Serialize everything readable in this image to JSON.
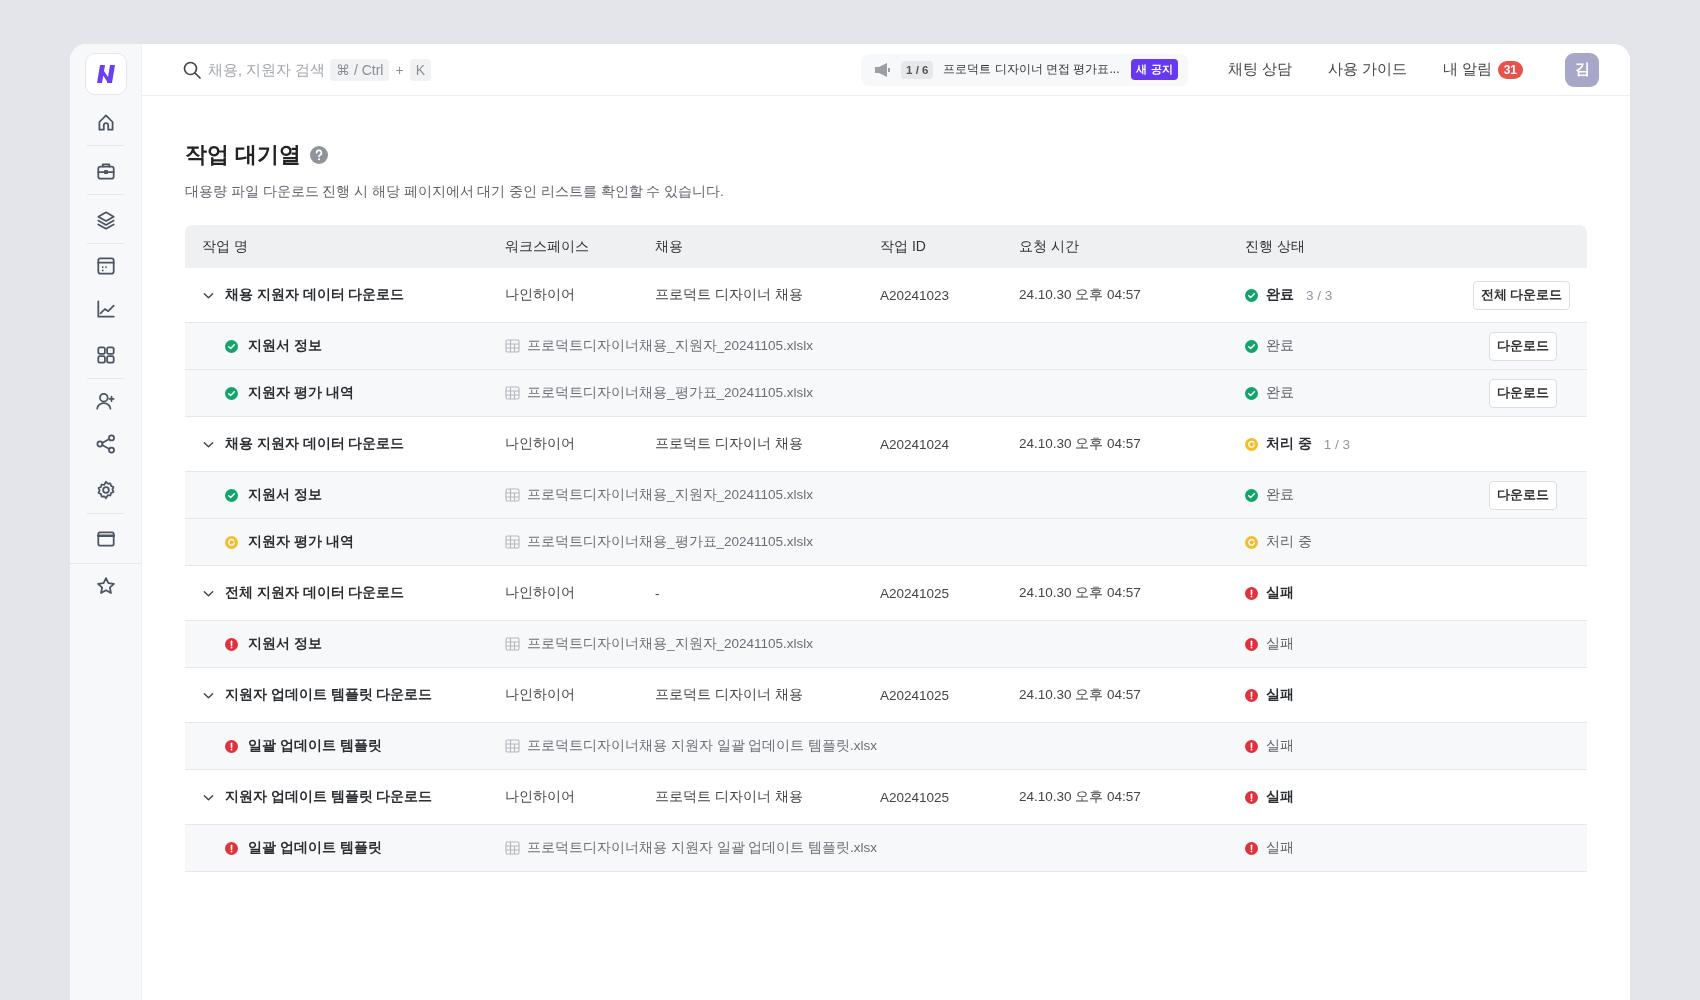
{
  "topbar": {
    "search": {
      "placeholder": "채용, 지원자 검색",
      "shortcut": [
        "⌘ / Ctrl",
        "K"
      ],
      "joiner": "+"
    },
    "notice": {
      "counter": "1 / 6",
      "text": "프로덕트 디자이너 면접 평가표...",
      "badge": "새 공지"
    },
    "links": [
      "채팅 상담",
      "사용 가이드"
    ],
    "alerts": {
      "label": "내 알림",
      "count": "31"
    },
    "avatar": "김"
  },
  "page": {
    "title": "작업 대기열",
    "description": "대용량 파일 다운로드 진행 시 해당 페이지에서 대기 중인 리스트를 확인할 수 있습니다."
  },
  "table": {
    "columns": [
      "작업 명",
      "워크스페이스",
      "채용",
      "작업 ID",
      "요청 시간",
      "진행 상태"
    ],
    "jobs": [
      {
        "name": "채용 지원자 데이터 다운로드",
        "expanded": true,
        "workspace": "나인하이어",
        "recruitment": "프로덕트 디자이너 채용",
        "job_id": "A20241023",
        "requested_at": "24.10.30 오후 04:57",
        "kind": "done",
        "status_label": "완료",
        "progress": "3 / 3",
        "action": "전체 다운로드",
        "children": [
          {
            "name": "지원서 정보",
            "kind": "done",
            "file": "프로덕트디자이너채용_지원자_20241105.xlslx",
            "status_label": "완료",
            "action": "다운로드"
          },
          {
            "name": "지원자 평가 내역",
            "kind": "done",
            "file": "프로덕트디자이너채용_평가표_20241105.xlslx",
            "status_label": "완료",
            "action": "다운로드"
          }
        ]
      },
      {
        "name": "채용 지원자 데이터 다운로드",
        "expanded": true,
        "workspace": "나인하이어",
        "recruitment": "프로덕트 디자이너 채용",
        "job_id": "A20241024",
        "requested_at": "24.10.30 오후 04:57",
        "kind": "processing",
        "status_label": "처리 중",
        "progress": "1 / 3",
        "children": [
          {
            "name": "지원서 정보",
            "kind": "done",
            "file": "프로덕트디자이너채용_지원자_20241105.xlslx",
            "status_label": "완료",
            "action": "다운로드"
          },
          {
            "name": "지원자 평가 내역",
            "kind": "processing",
            "file": "프로덕트디자이너채용_평가표_20241105.xlslx",
            "status_label": "처리 중"
          }
        ]
      },
      {
        "name": "전체 지원자 데이터 다운로드",
        "expanded": true,
        "workspace": "나인하이어",
        "recruitment": "-",
        "job_id": "A20241025",
        "requested_at": "24.10.30 오후 04:57",
        "kind": "failed",
        "status_label": "실패",
        "children": [
          {
            "name": "지원서 정보",
            "kind": "failed",
            "file": "프로덕트디자이너채용_지원자_20241105.xlslx",
            "status_label": "실패"
          }
        ]
      },
      {
        "name": "지원자 업데이트 템플릿 다운로드",
        "expanded": true,
        "workspace": "나인하이어",
        "recruitment": "프로덕트 디자이너 채용",
        "job_id": "A20241025",
        "requested_at": "24.10.30 오후 04:57",
        "kind": "failed",
        "status_label": "실패",
        "children": [
          {
            "name": "일괄 업데이트 템플릿",
            "kind": "failed",
            "file": "프로덕트디자이너채용 지원자 일괄 업데이트 템플릿.xlsx",
            "status_label": "실패"
          }
        ]
      },
      {
        "name": "지원자 업데이트 템플릿 다운로드",
        "expanded": true,
        "workspace": "나인하이어",
        "recruitment": "프로덕트 디자이너 채용",
        "job_id": "A20241025",
        "requested_at": "24.10.30 오후 04:57",
        "kind": "failed",
        "status_label": "실패",
        "children": [
          {
            "name": "일괄 업데이트 템플릿",
            "kind": "failed",
            "file": "프로덕트디자이너채용 지원자 일괄 업데이트 템플릿.xlsx",
            "status_label": "실패"
          }
        ]
      }
    ]
  }
}
